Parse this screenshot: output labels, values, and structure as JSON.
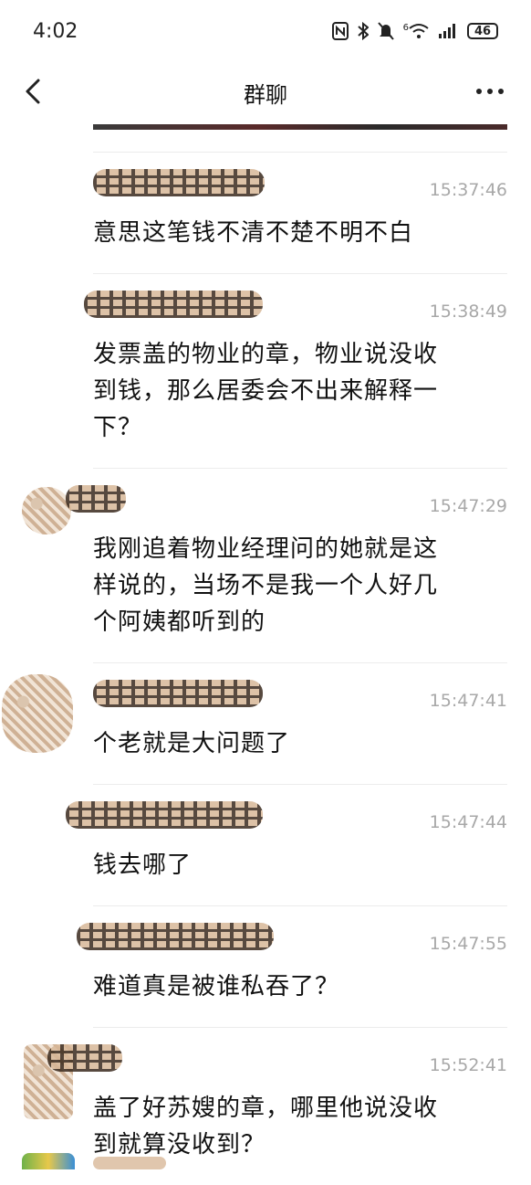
{
  "status_bar": {
    "time": "4:02",
    "network": "6",
    "battery": "46"
  },
  "header": {
    "title": "群聊"
  },
  "messages": [
    {
      "time": "15:37:46",
      "text": "意思这笔钱不清不楚不明不白"
    },
    {
      "time": "15:38:49",
      "text": "发票盖的物业的章，物业说没收\n到钱，那么居委会不出来解释一\n下？"
    },
    {
      "time": "15:47:29",
      "text": "我刚追着物业经理问的她就是这\n样说的，当场不是我一个人好几\n个阿姨都听到的"
    },
    {
      "time": "15:47:41",
      "text": "个老就是大问题了"
    },
    {
      "time": "15:47:44",
      "text": "钱去哪了"
    },
    {
      "time": "15:47:55",
      "text": "难道真是被谁私吞了？"
    },
    {
      "time": "15:52:41",
      "text": "盖了好苏嫂的章，哪里他说没收\n到就算没收到？"
    }
  ]
}
